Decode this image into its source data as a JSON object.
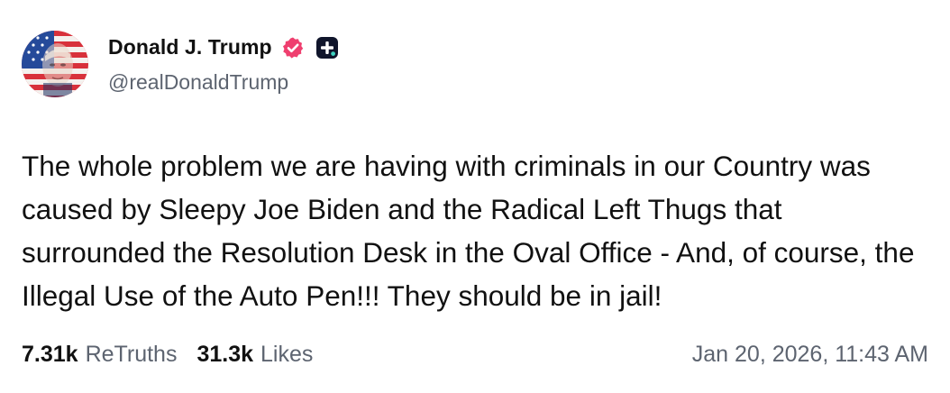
{
  "author": {
    "display_name": "Donald J. Trump",
    "handle": "@realDonaldTrump",
    "avatar_icon": "flag-portrait-avatar",
    "verified_icon": "verified-badge-icon",
    "verified_color": "#ef3f6f",
    "plus_icon": "plus-badge-icon"
  },
  "post": {
    "text": "The whole problem we are having with criminals in our Country was caused by Sleepy Joe Biden and the Radical Left Thugs that surrounded the Resolution Desk in the Oval Office - And, of course, the Illegal Use of the Auto Pen!!! They should be in jail!"
  },
  "stats": {
    "retruths_count": "7.31k",
    "retruths_label": "ReTruths",
    "likes_count": "31.3k",
    "likes_label": "Likes"
  },
  "timestamp": "Jan 20, 2026, 11:43 AM",
  "colors": {
    "text_primary": "#111111",
    "text_secondary": "#5d6470",
    "background": "#ffffff"
  }
}
